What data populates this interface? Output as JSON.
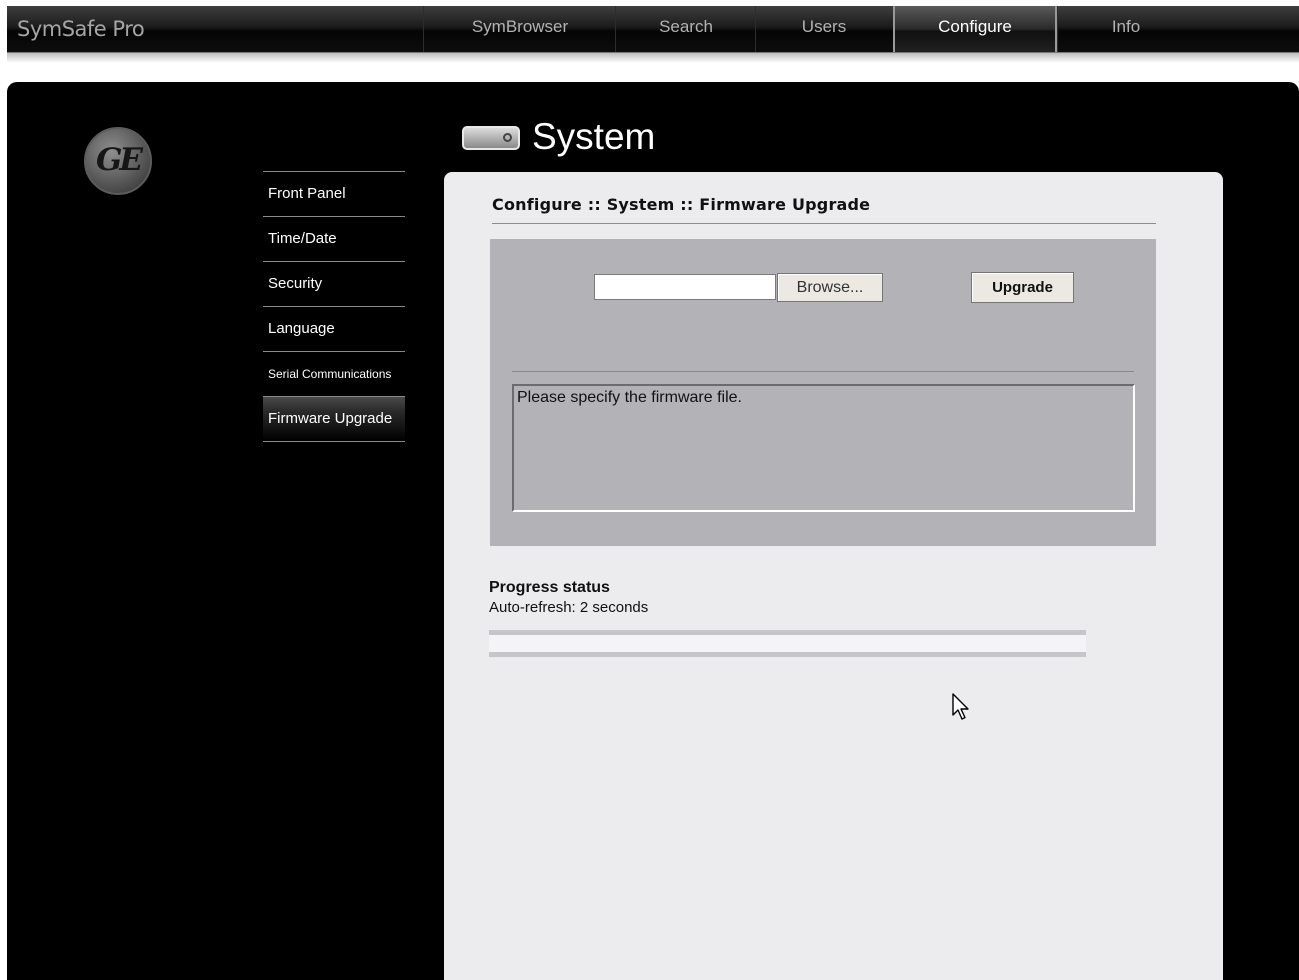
{
  "app": {
    "title": "SymSafe Pro"
  },
  "nav": {
    "tabs": [
      {
        "label": "SymBrowser",
        "active": false
      },
      {
        "label": "Search",
        "active": false
      },
      {
        "label": "Users",
        "active": false
      },
      {
        "label": "Configure",
        "active": true
      },
      {
        "label": "Info",
        "active": false
      }
    ]
  },
  "brand": {
    "logo": "ge-logo",
    "logo_text": "GE"
  },
  "sidebar": {
    "items": [
      {
        "label": "Front Panel",
        "active": false
      },
      {
        "label": "Time/Date",
        "active": false
      },
      {
        "label": "Security",
        "active": false
      },
      {
        "label": "Language",
        "active": false
      },
      {
        "label": "Serial Communications",
        "active": false
      },
      {
        "label": "Firmware Upgrade",
        "active": true
      }
    ]
  },
  "section": {
    "icon": "device-icon",
    "title": "System"
  },
  "page": {
    "breadcrumb": "Configure :: System :: Firmware Upgrade",
    "file_input": {
      "value": "",
      "placeholder": ""
    },
    "browse_label": "Browse...",
    "upgrade_label": "Upgrade",
    "message": "Please specify the firmware file."
  },
  "progress": {
    "title": "Progress status",
    "refresh_label": "Auto-refresh: 2 seconds",
    "fraction": 0
  },
  "colors": {
    "panel": "#000000",
    "card": "#ecebee",
    "upload_area": "#b3b2b7"
  }
}
